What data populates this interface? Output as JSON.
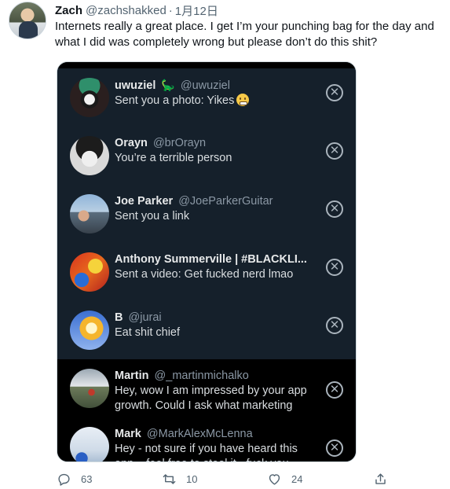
{
  "tweet": {
    "author_name": "Zach",
    "author_handle": "@zachshakked",
    "separator": "·",
    "date": "1月12日",
    "text": "Internets really a great place. I get I’m your punching bag for the day and what I did was completely wrong but please don’t do this shit?"
  },
  "dms": [
    {
      "name": "uwuziel",
      "badge": "🦕",
      "handle": "@uwuziel",
      "message": "Sent you a photo: Yikes",
      "emoji": "grimacing-face",
      "avatar_icon": "skull-avatar-icon"
    },
    {
      "name": "Orayn",
      "handle": "@brOrayn",
      "message": "You’re a terrible person",
      "avatar_icon": "cartoon-avatar-icon"
    },
    {
      "name": "Joe Parker",
      "handle": "@JoeParkerGuitar",
      "message": "Sent you a link",
      "avatar_icon": "photo-avatar-icon"
    },
    {
      "name": "Anthony Summerville | #BLACKLI...",
      "handle": "",
      "message": "Sent a video: Get fucked nerd lmao",
      "avatar_icon": "colorful-avatar-icon"
    },
    {
      "name": "B",
      "handle": "@jurai",
      "message": "Eat shit chief",
      "avatar_icon": "flame-avatar-icon"
    },
    {
      "name": "Martin",
      "handle": "@_martinmichalko",
      "message": "Hey, wow I am impressed by your app growth. Could I ask what marketing",
      "avatar_icon": "landscape-avatar-icon"
    },
    {
      "name": "Mark",
      "handle": "@MarkAlexMcLenna",
      "message": "Hey - not sure if you have heard this app... feel free to steal it - fuck you",
      "avatar_icon": "sign-avatar-icon"
    }
  ],
  "close_glyph": "✕",
  "actions": {
    "replies": "63",
    "retweets": "10",
    "likes": "24"
  },
  "colors": {
    "dm_background": "#15202b",
    "dm_background_dark": "#000000",
    "text_secondary": "#536471"
  }
}
